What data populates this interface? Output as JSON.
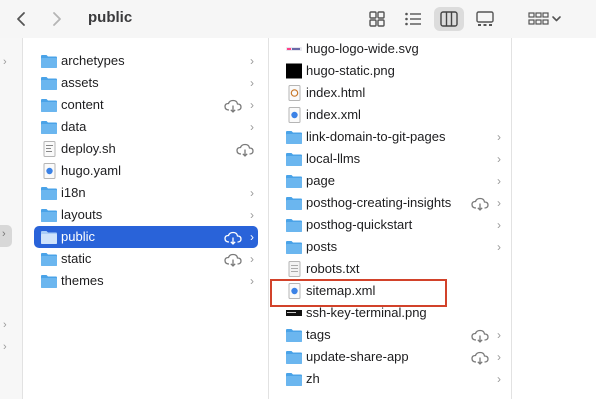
{
  "window": {
    "title": "public"
  },
  "toolbar": {
    "views": [
      "icon-view",
      "list-view",
      "column-view",
      "gallery-view"
    ],
    "selected_view": "column-view",
    "group_button": "group-by"
  },
  "column1": {
    "items": [
      {
        "name": "archetypes",
        "kind": "folder",
        "chevron": true
      },
      {
        "name": "assets",
        "kind": "folder",
        "chevron": true
      },
      {
        "name": "content",
        "kind": "folder",
        "chevron": true,
        "cloud": true
      },
      {
        "name": "data",
        "kind": "folder",
        "chevron": true
      },
      {
        "name": "deploy.sh",
        "kind": "script",
        "cloud": true
      },
      {
        "name": "hugo.yaml",
        "kind": "yaml"
      },
      {
        "name": "i18n",
        "kind": "folder",
        "chevron": true
      },
      {
        "name": "layouts",
        "kind": "folder",
        "chevron": true
      },
      {
        "name": "public",
        "kind": "folder",
        "chevron": true,
        "cloud": true,
        "selected": true
      },
      {
        "name": "static",
        "kind": "folder",
        "chevron": true,
        "cloud": true
      },
      {
        "name": "themes",
        "kind": "folder",
        "chevron": true
      }
    ]
  },
  "column2": {
    "items": [
      {
        "name": "hugo-logo-wide.svg",
        "kind": "svg"
      },
      {
        "name": "hugo-static.png",
        "kind": "image-black"
      },
      {
        "name": "index.html",
        "kind": "html"
      },
      {
        "name": "index.xml",
        "kind": "xml"
      },
      {
        "name": "link-domain-to-git-pages",
        "kind": "folder",
        "chevron": true
      },
      {
        "name": "local-llms",
        "kind": "folder",
        "chevron": true
      },
      {
        "name": "page",
        "kind": "folder",
        "chevron": true
      },
      {
        "name": "posthog-creating-insights",
        "kind": "folder",
        "chevron": true,
        "cloud": true
      },
      {
        "name": "posthog-quickstart",
        "kind": "folder",
        "chevron": true
      },
      {
        "name": "posts",
        "kind": "folder",
        "chevron": true
      },
      {
        "name": "robots.txt",
        "kind": "text"
      },
      {
        "name": "sitemap.xml",
        "kind": "xml",
        "highlighted": true
      },
      {
        "name": "ssh-key-terminal.png",
        "kind": "image-dark"
      },
      {
        "name": "tags",
        "kind": "folder",
        "chevron": true,
        "cloud": true
      },
      {
        "name": "update-share-app",
        "kind": "folder",
        "chevron": true,
        "cloud": true
      },
      {
        "name": "zh",
        "kind": "folder",
        "chevron": true
      }
    ]
  },
  "chevron_glyph": "›",
  "colors": {
    "folder": "#4aa3e8",
    "selection": "#2963d9",
    "highlight_border": "#d2422a"
  }
}
